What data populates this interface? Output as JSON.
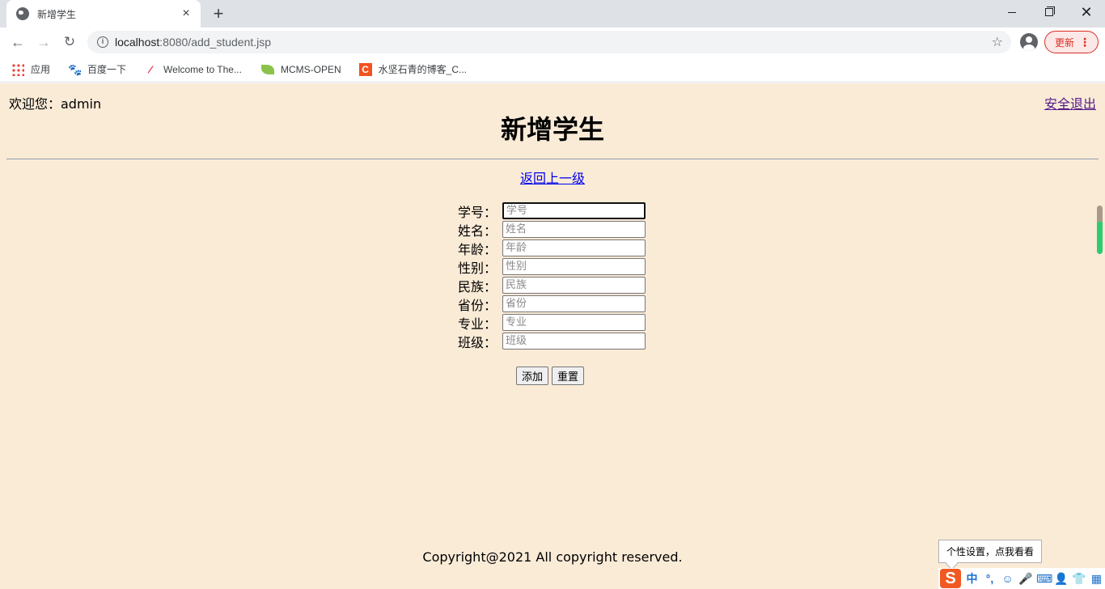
{
  "browser": {
    "tab_title": "新增学生",
    "tab_close_icon": "×",
    "new_tab_icon": "+",
    "url_host": "localhost",
    "url_path": ":8080/add_student.jsp",
    "update_label": "更新",
    "menu_dots": "⋮",
    "bookmarks": [
      {
        "label": "应用",
        "icon": "apps-grid-icon"
      },
      {
        "label": "百度一下",
        "icon": "baidu-paw-icon"
      },
      {
        "label": "Welcome to The...",
        "icon": "feather-icon"
      },
      {
        "label": "MCMS-OPEN",
        "icon": "leaf-icon"
      },
      {
        "label": "水坚石青的博客_C...",
        "icon": "csdn-icon"
      }
    ]
  },
  "page": {
    "welcome": "欢迎您：admin",
    "logout_link": "安全退出",
    "title": "新增学生",
    "back_link": "返回上一级",
    "form": {
      "fields": [
        {
          "label": "学号：",
          "placeholder": "学号",
          "value": ""
        },
        {
          "label": "姓名：",
          "placeholder": "姓名",
          "value": ""
        },
        {
          "label": "年龄：",
          "placeholder": "年龄",
          "value": ""
        },
        {
          "label": "性别：",
          "placeholder": "性别",
          "value": ""
        },
        {
          "label": "民族：",
          "placeholder": "民族",
          "value": ""
        },
        {
          "label": "省份：",
          "placeholder": "省份",
          "value": ""
        },
        {
          "label": "专业：",
          "placeholder": "专业",
          "value": ""
        },
        {
          "label": "班级：",
          "placeholder": "班级",
          "value": ""
        }
      ],
      "submit_label": "添加",
      "reset_label": "重置"
    },
    "footer": "Copyright@2021 All copyright reserved.",
    "background_color": "#faebd7"
  },
  "ime": {
    "tooltip": "个性设置，点我看看",
    "logo": "S",
    "items": [
      "中",
      "°,",
      "☺",
      "🎤",
      "⌨",
      "👤",
      "👕",
      "▦"
    ]
  }
}
